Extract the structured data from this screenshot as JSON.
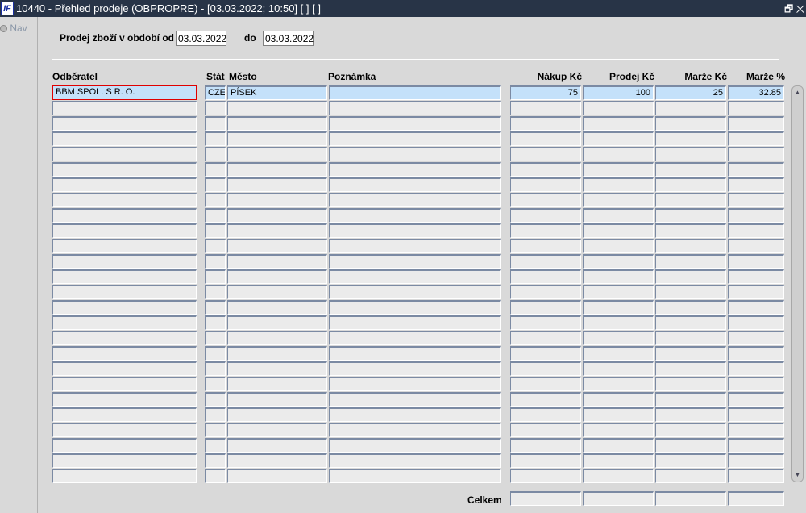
{
  "window": {
    "title": "10440 - Přehled prodeje (OBPROPRE) - [03.03.2022; 10:50]  [ ]  [ ]",
    "logo": "IF",
    "restore_icon": "restore-icon",
    "close_icon": "close-icon"
  },
  "nav": {
    "label": "Nav"
  },
  "filter": {
    "label_from": "Prodej zboží v období od",
    "date_from": "03.03.2022",
    "label_to": "do",
    "date_to": "03.03.2022"
  },
  "columns": {
    "customer": "Odběratel",
    "country": "Stát",
    "city": "Město",
    "note": "Poznámka",
    "purchase": "Nákup Kč",
    "sale": "Prodej Kč",
    "margin": "Marže Kč",
    "margin_pct": "Marže %"
  },
  "rows": [
    {
      "customer": "BBM SPOL. S R. O.",
      "country": "CZE",
      "city": "PÍSEK",
      "note": "",
      "purchase": "75",
      "sale": "100",
      "margin": "25",
      "margin_pct": "32.85"
    }
  ],
  "total_rows": 26,
  "totals": {
    "label": "Celkem",
    "purchase": "",
    "sale": "",
    "margin": "",
    "margin_pct": ""
  }
}
